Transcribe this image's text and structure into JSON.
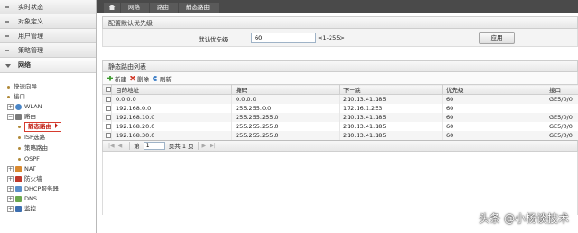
{
  "sidebar": {
    "sections": [
      {
        "label": "实时状态"
      },
      {
        "label": "对象定义"
      },
      {
        "label": "用户管理"
      },
      {
        "label": "策略管理"
      }
    ],
    "open_section": {
      "label": "网络"
    },
    "tree": {
      "quick_guide": "快速向导",
      "interface": "接口",
      "wlan": "WLAN",
      "routing": "路由",
      "static_route": "静态路由",
      "isp_route": "ISP选路",
      "policy_route": "策略路由",
      "ospf": "OSPF",
      "nat": "NAT",
      "firewall": "防火墙",
      "dhcp_server": "DHCP服务器",
      "dns": "DNS",
      "monitor": "监控"
    }
  },
  "breadcrumb": {
    "items": [
      "网络",
      "路由",
      "静态路由"
    ]
  },
  "config": {
    "title": "配置默认优先级",
    "priority_label": "默认优先级",
    "priority_value": "60",
    "range_hint": "<1-255>",
    "apply_label": "应用"
  },
  "list": {
    "title": "静态路由列表",
    "toolbar": {
      "add": "新建",
      "delete": "删除",
      "refresh": "刷新"
    },
    "columns": [
      "目的地址",
      "掩码",
      "下一跳",
      "优先级",
      "接口"
    ],
    "rows": [
      [
        "0.0.0.0",
        "0.0.0.0",
        "210.13.41.185",
        "60",
        "GE5/0/0"
      ],
      [
        "192.168.0.0",
        "255.255.0.0",
        "172.16.1.253",
        "60",
        ""
      ],
      [
        "192.168.10.0",
        "255.255.255.0",
        "210.13.41.185",
        "60",
        "GE5/0/0"
      ],
      [
        "192.168.20.0",
        "255.255.255.0",
        "210.13.41.185",
        "60",
        "GE5/0/0"
      ],
      [
        "192.168.30.0",
        "255.255.255.0",
        "210.13.41.185",
        "60",
        "GE5/0/0"
      ]
    ],
    "pager": {
      "page_prefix": "第",
      "page_value": "1",
      "page_suffix": "页共 1 页"
    }
  },
  "watermark": "头条 @小杨谈技术"
}
